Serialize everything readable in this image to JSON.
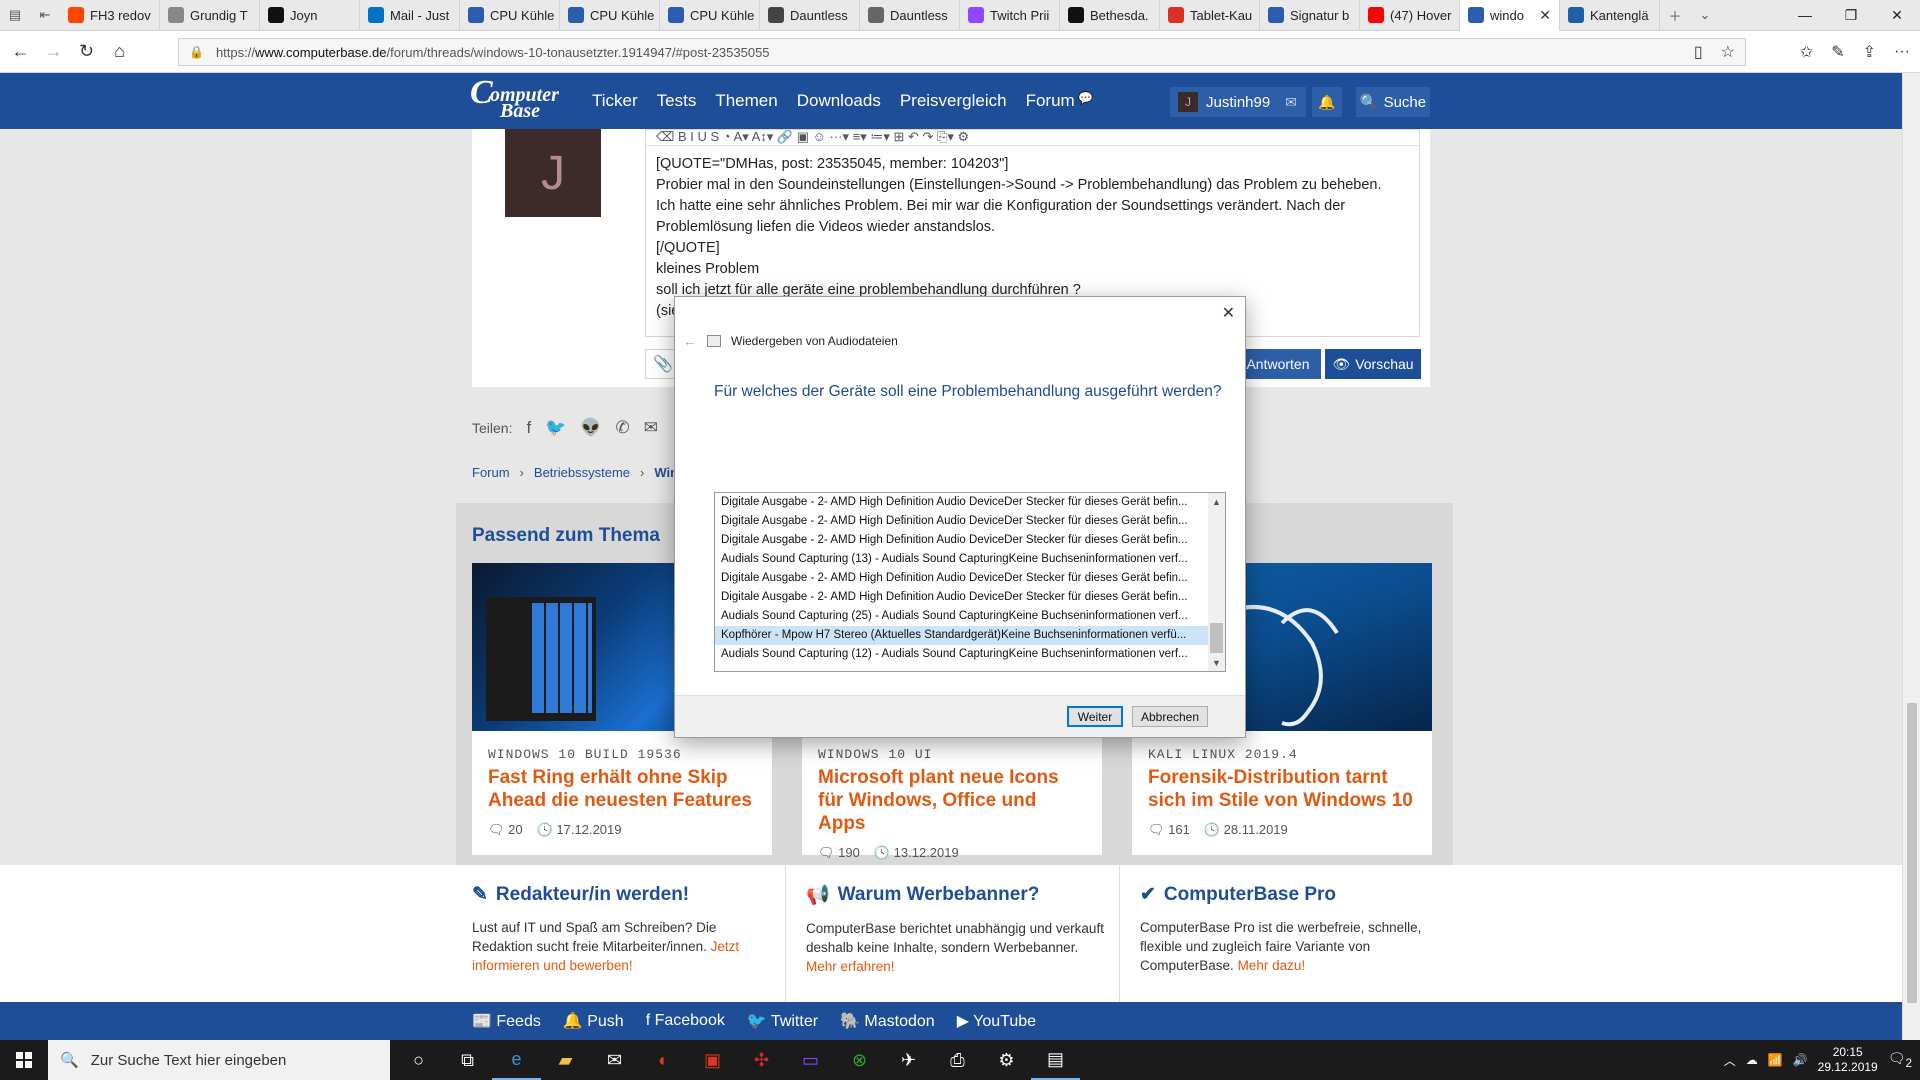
{
  "browser": {
    "tabs": [
      {
        "label": "FH3 redov",
        "color": "#ff4500"
      },
      {
        "label": "Grundig T",
        "color": "#888888"
      },
      {
        "label": "Joyn",
        "color": "#111111"
      },
      {
        "label": "Mail - Just",
        "color": "#0072c6"
      },
      {
        "label": "CPU Kühle",
        "color": "#2a5db0"
      },
      {
        "label": "CPU Kühle",
        "color": "#2a5db0"
      },
      {
        "label": "CPU Kühle",
        "color": "#2a5db0"
      },
      {
        "label": "Dauntless",
        "color": "#444444"
      },
      {
        "label": "Dauntless",
        "color": "#666666"
      },
      {
        "label": "Twitch Prii",
        "color": "#9146ff"
      },
      {
        "label": "Bethesda.",
        "color": "#111111"
      },
      {
        "label": "Tablet-Kau",
        "color": "#d93025"
      },
      {
        "label": "Signatur b",
        "color": "#2a5db0"
      },
      {
        "label": "(47) Hover",
        "color": "#ff0000"
      },
      {
        "label": "windo",
        "color": "#2a5db0",
        "active": true
      },
      {
        "label": "Kantenglä",
        "color": "#1f5fa8"
      }
    ],
    "url_prefix": "https://",
    "url_domain": "www.computerbase.de",
    "url_path": "/forum/threads/windows-10-tonausetzter.1914947/#post-23535055"
  },
  "site": {
    "nav": [
      "Ticker",
      "Tests",
      "Themen",
      "Downloads",
      "Preisvergleich",
      "Forum"
    ],
    "user_initial": "J",
    "username": "Justinh99",
    "search_label": "Suche"
  },
  "editor": {
    "avatar_initial": "J",
    "toolbar_glyphs": "⌫   B   I   U   S   ◔   A▾  A↕▾  🔗   ▣   ☺   ···▾   ≡▾  ≔▾  ⊞   ↶   ↷   ⎘▾  ⚙",
    "lines": [
      "[QUOTE=\"DMHas, post: 23535045, member: 104203\"]",
      "Probier mal in den Soundeinstellungen (Einstellungen->Sound -> Problembehandlung) das Problem zu beheben.",
      "Ich hatte eine sehr ähnliches Problem. Bei mir war die Konfiguration der Soundsettings verändert. Nach der",
      "Problemlösung liefen die Videos wieder anstandslos.",
      "[/QUOTE]",
      "kleines Problem",
      "soll ich jetzt für alle geräte eine problembehandlung durchführen ?",
      "(sie"
    ],
    "reply_label": "Antworten",
    "preview_label": "Vorschau"
  },
  "share": {
    "label": "Teilen:"
  },
  "breadcrumb": {
    "items": [
      "Forum",
      "Betriebssysteme",
      "Wind"
    ]
  },
  "related": {
    "heading": "Passend zum Thema",
    "cards": [
      {
        "kicker": "WINDOWS 10 BUILD 19536",
        "title": "Fast Ring erhält ohne Skip Ahead die neuesten Features",
        "comments": "20",
        "date": "17.12.2019"
      },
      {
        "kicker": "WINDOWS 10 UI",
        "title": "Microsoft plant neue Icons für Windows, Office und Apps",
        "comments": "190",
        "date": "13.12.2019"
      },
      {
        "kicker": "KALI LINUX 2019.4",
        "title": "Forensik-Distribution tarnt sich im Stile von Windows 10",
        "comments": "161",
        "date": "28.11.2019"
      }
    ]
  },
  "promo": [
    {
      "title": "Redakteur/in werden!",
      "text": "Lust auf IT und Spaß am Schreiben? Die Redaktion sucht freie Mitarbeiter/innen.",
      "link": "Jetzt informieren und bewerben!"
    },
    {
      "title": "Warum Werbebanner?",
      "text": "ComputerBase berichtet unabhängig und verkauft deshalb keine Inhalte, sondern Werbebanner.",
      "link": "Mehr erfahren!"
    },
    {
      "title": "ComputerBase Pro",
      "text": "ComputerBase Pro ist die werbefreie, schnelle, flexible und zugleich faire Variante von ComputerBase.",
      "link": "Mehr dazu!"
    }
  ],
  "footer": [
    "Feeds",
    "Push",
    "Facebook",
    "Twitter",
    "Mastodon",
    "YouTube"
  ],
  "dialog": {
    "title": "Wiedergeben von Audiodateien",
    "question": "Für welches der Geräte soll eine Problembehandlung ausgeführt werden?",
    "items": [
      "Digitale Ausgabe - 2- AMD High Definition Audio DeviceDer Stecker für dieses Gerät befin...",
      "Digitale Ausgabe - 2- AMD High Definition Audio DeviceDer Stecker für dieses Gerät befin...",
      "Digitale Ausgabe - 2- AMD High Definition Audio DeviceDer Stecker für dieses Gerät befin...",
      "Audials Sound Capturing (13) - Audials Sound CapturingKeine Buchseninformationen verf...",
      "Digitale Ausgabe - 2- AMD High Definition Audio DeviceDer Stecker für dieses Gerät befin...",
      "Digitale Ausgabe - 2- AMD High Definition Audio DeviceDer Stecker für dieses Gerät befin...",
      "Audials Sound Capturing (25) - Audials Sound CapturingKeine Buchseninformationen verf...",
      "Kopfhörer - Mpow H7 Stereo (Aktuelles Standardgerät)Keine Buchseninformationen verfü...",
      "Audials Sound Capturing (12) - Audials Sound CapturingKeine Buchseninformationen verf..."
    ],
    "selected_index": 7,
    "next_label": "Weiter",
    "cancel_label": "Abbrechen"
  },
  "taskbar": {
    "search_placeholder": "Zur Suche Text hier eingeben",
    "time": "20:15",
    "date": "29.12.2019",
    "notifications": "2"
  }
}
